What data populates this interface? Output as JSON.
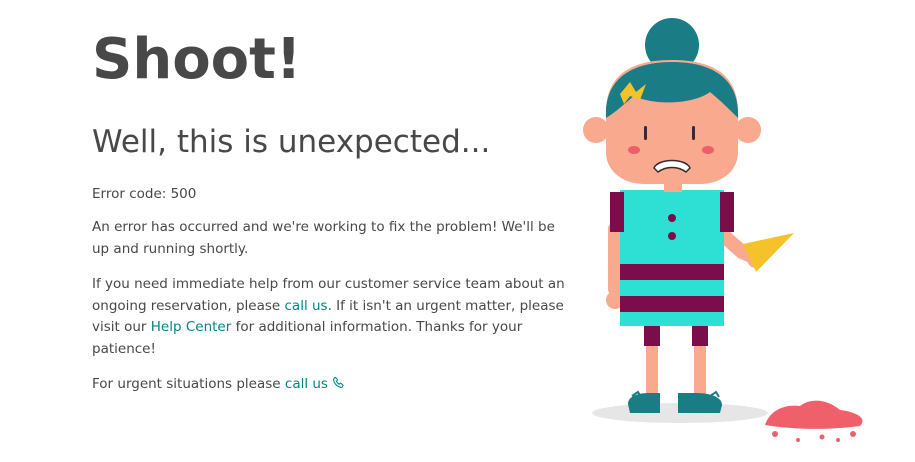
{
  "page": {
    "headline": "Shoot!",
    "subheadline": "Well, this is unexpected...",
    "error_code": "Error code: 500",
    "message": "An error has occurred and we're working to fix the problem! We'll be up and running shortly.",
    "help": {
      "text_1": "If you need immediate help from our customer service team about an ongoing reservation, please ",
      "call_link": "call us",
      "text_2": ". If it isn't an urgent matter, please visit our ",
      "help_center_link": "Help Center",
      "text_3": " for additional information. Thanks for your patience!"
    },
    "urgent": {
      "text": "For urgent situations please ",
      "call_link": "call us"
    }
  },
  "icons": {
    "phone": "phone-icon"
  },
  "colors": {
    "text": "#484848",
    "link": "#008489",
    "hair": "#1a7c85",
    "dress_teal": "#2ee0d4",
    "dress_stripe": "#7a0d4a",
    "skin": "#f8a98e",
    "bow": "#f6c22b",
    "ice_cream_splat": "#f0606a"
  }
}
